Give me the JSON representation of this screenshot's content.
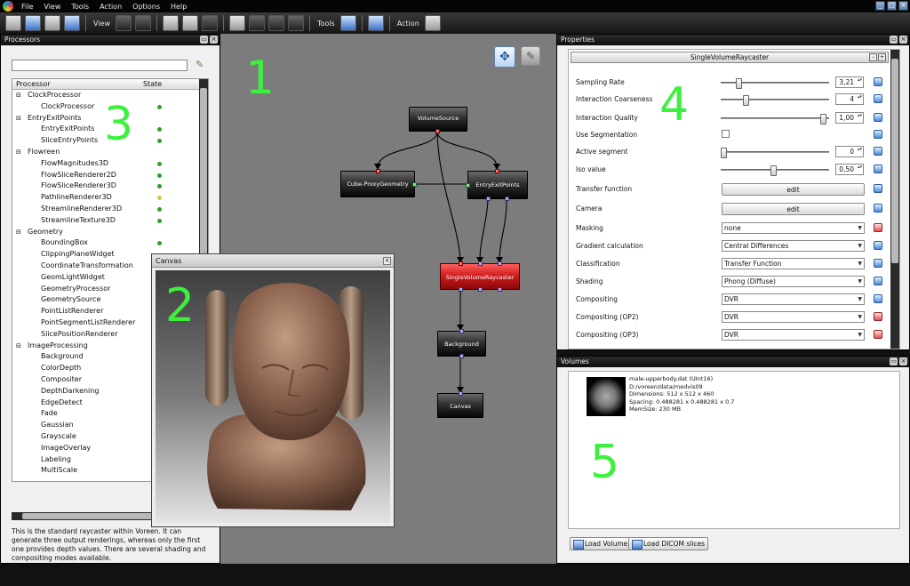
{
  "menu": [
    "File",
    "View",
    "Tools",
    "Action",
    "Options",
    "Help"
  ],
  "toolbar": {
    "view_label": "View",
    "tools_label": "Tools",
    "action_label": "Action"
  },
  "window_buttons": [
    "_",
    "□",
    "×"
  ],
  "processors_panel": {
    "title": "Processors",
    "col_processor": "Processor",
    "col_state": "State",
    "tree": [
      {
        "type": "group",
        "label": "ClockProcessor"
      },
      {
        "type": "item",
        "label": "ClockProcessor",
        "state": "green"
      },
      {
        "type": "group",
        "label": "EntryExitPoints"
      },
      {
        "type": "item",
        "label": "EntryExitPoints",
        "state": "green"
      },
      {
        "type": "item",
        "label": "SliceEntryPoints",
        "state": "green"
      },
      {
        "type": "group",
        "label": "Flowreen"
      },
      {
        "type": "item",
        "label": "FlowMagnitudes3D",
        "state": "green"
      },
      {
        "type": "item",
        "label": "FlowSliceRenderer2D",
        "state": "green"
      },
      {
        "type": "item",
        "label": "FlowSliceRenderer3D",
        "state": "green"
      },
      {
        "type": "item",
        "label": "PathlineRenderer3D",
        "state": "yellow"
      },
      {
        "type": "item",
        "label": "StreamlineRenderer3D",
        "state": "green"
      },
      {
        "type": "item",
        "label": "StreamlineTexture3D",
        "state": "green"
      },
      {
        "type": "group",
        "label": "Geometry"
      },
      {
        "type": "item",
        "label": "BoundingBox",
        "state": "green"
      },
      {
        "type": "item",
        "label": "ClippingPlaneWidget",
        "state": "none"
      },
      {
        "type": "item",
        "label": "CoordinateTransformation",
        "state": "none"
      },
      {
        "type": "item",
        "label": "GeomLightWidget",
        "state": "none"
      },
      {
        "type": "item",
        "label": "GeometryProcessor",
        "state": "none"
      },
      {
        "type": "item",
        "label": "GeometrySource",
        "state": "none"
      },
      {
        "type": "item",
        "label": "PointListRenderer",
        "state": "none"
      },
      {
        "type": "item",
        "label": "PointSegmentListRenderer",
        "state": "none"
      },
      {
        "type": "item",
        "label": "SlicePositionRenderer",
        "state": "none"
      },
      {
        "type": "group",
        "label": "ImageProcessing"
      },
      {
        "type": "item",
        "label": "Background",
        "state": "none"
      },
      {
        "type": "item",
        "label": "ColorDepth",
        "state": "none"
      },
      {
        "type": "item",
        "label": "Compositer",
        "state": "none"
      },
      {
        "type": "item",
        "label": "DepthDarkening",
        "state": "none"
      },
      {
        "type": "item",
        "label": "EdgeDetect",
        "state": "none"
      },
      {
        "type": "item",
        "label": "Fade",
        "state": "none"
      },
      {
        "type": "item",
        "label": "Gaussian",
        "state": "none"
      },
      {
        "type": "item",
        "label": "Grayscale",
        "state": "none"
      },
      {
        "type": "item",
        "label": "ImageOverlay",
        "state": "none"
      },
      {
        "type": "item",
        "label": "Labeling",
        "state": "none"
      },
      {
        "type": "item",
        "label": "MultiScale",
        "state": "none"
      }
    ],
    "description": "This is the standard raycaster within Voreen. It can generate three output renderings, whereas only the first one provides depth values. There are several shading and compositing modes available."
  },
  "network": {
    "nodes": {
      "volume_source": "VolumeSource",
      "cube_proxy": "Cube-ProxyGeometry",
      "entry_exit": "EntryExitPoints",
      "raycaster": "SingleVolumeRaycaster",
      "background": "Background",
      "canvas": "Canvas"
    }
  },
  "canvas_window": {
    "title": "Canvas"
  },
  "properties_panel": {
    "title": "Properties",
    "processor_name": "SingleVolumeRaycaster",
    "rows": {
      "sampling_rate": {
        "label": "Sampling Rate",
        "value": "3,21",
        "slider": 0.15
      },
      "interaction_coarseness": {
        "label": "Interaction Coarseness",
        "value": "4",
        "slider": 0.22
      },
      "interaction_quality": {
        "label": "Interaction Quality",
        "value": "1,00",
        "slider": 1.0
      },
      "use_segmentation": {
        "label": "Use Segmentation"
      },
      "active_segment": {
        "label": "Active segment",
        "value": "0",
        "slider": 0.0
      },
      "iso_value": {
        "label": "Iso value",
        "value": "0,50",
        "slider": 0.5
      },
      "transfer_function": {
        "label": "Transfer function",
        "button": "edit"
      },
      "camera": {
        "label": "Camera",
        "button": "edit"
      },
      "masking": {
        "label": "Masking",
        "option": "none"
      },
      "gradient": {
        "label": "Gradient calculation",
        "option": "Central Differences"
      },
      "classification": {
        "label": "Classification",
        "option": "Transfer Function"
      },
      "shading": {
        "label": "Shading",
        "option": "Phong (Diffuse)"
      },
      "compositing": {
        "label": "Compositing",
        "option": "DVR"
      },
      "compositing_op2": {
        "label": "Compositing (OP2)",
        "option": "DVR"
      },
      "compositing_op3": {
        "label": "Compositing (OP3)",
        "option": "DVR"
      }
    }
  },
  "volumes_panel": {
    "title": "Volumes",
    "volume": {
      "name": "male-upperbody.dat (UInt16)",
      "path": "D:/voreen/data/medvis09",
      "dimensions": "Dimensions: 512 x 512 x 460",
      "spacing": "Spacing: 0.488281 x 0.488281 x 0.7",
      "memsize": "MemSize: 230 MB"
    },
    "load_volume": "Load Volume",
    "load_dicom": "Load DICOM slices"
  },
  "annotations": [
    "1",
    "2",
    "3",
    "4",
    "5"
  ],
  "colors": {
    "annotation": "#3df03d",
    "node_selected": "#d21e1e",
    "state_ok": "#2ea12e",
    "state_warn": "#d7c93a"
  }
}
